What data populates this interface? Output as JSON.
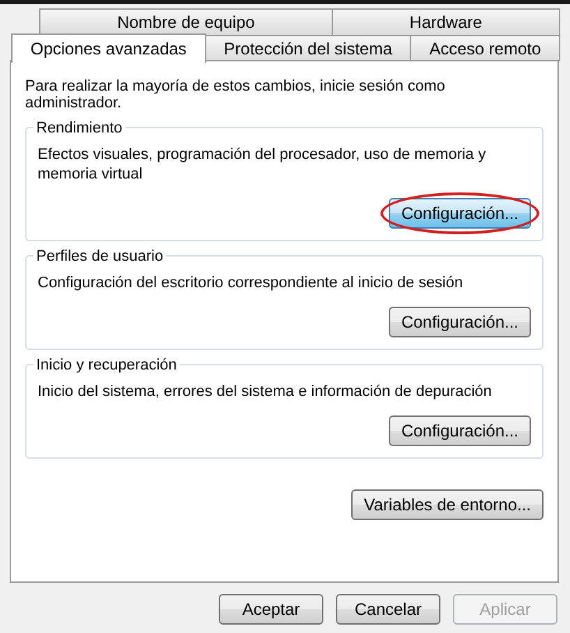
{
  "tab_rows": [
    [
      {
        "label": "Nombre de equipo",
        "selected": false
      },
      {
        "label": "Hardware",
        "selected": false
      }
    ],
    [
      {
        "label": "Opciones avanzadas",
        "selected": true
      },
      {
        "label": "Protección del sistema",
        "selected": false
      },
      {
        "label": "Acceso remoto",
        "selected": false
      }
    ]
  ],
  "intro": "Para realizar la mayoría de estos cambios, inicie sesión como administrador.",
  "groups": [
    {
      "title": "Rendimiento",
      "description": "Efectos visuales, programación del procesador, uso de memoria y memoria virtual",
      "button": {
        "label": "Configuración...",
        "highlighted": true
      }
    },
    {
      "title": "Perfiles de usuario",
      "description": "Configuración del escritorio correspondiente al inicio de sesión",
      "button": {
        "label": "Configuración...",
        "highlighted": false
      }
    },
    {
      "title": "Inicio y recuperación",
      "description": "Inicio del sistema, errores del sistema e información de depuración",
      "button": {
        "label": "Configuración...",
        "highlighted": false
      }
    }
  ],
  "env_button": "Variables de entorno...",
  "buttons": [
    {
      "label": "Aceptar",
      "disabled": false
    },
    {
      "label": "Cancelar",
      "disabled": false
    },
    {
      "label": "Aplicar",
      "disabled": true
    }
  ]
}
